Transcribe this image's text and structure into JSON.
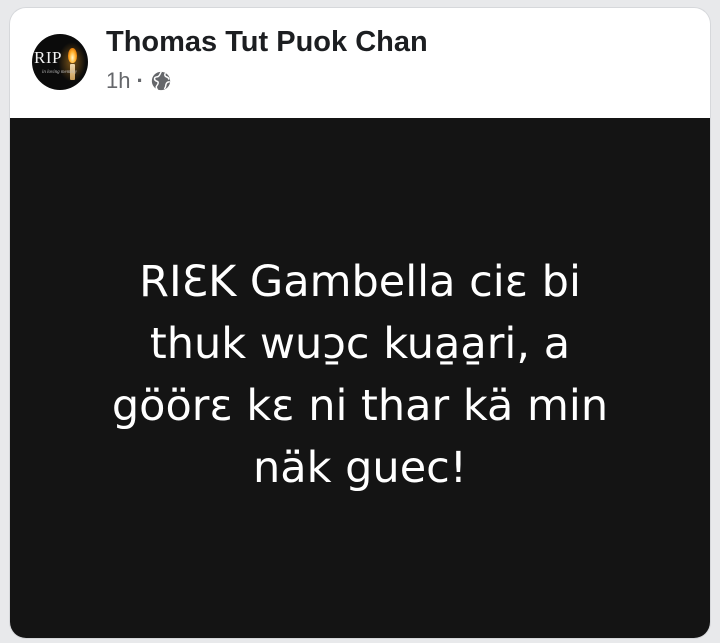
{
  "post": {
    "author": "Thomas Tut Puok Chan",
    "timestamp": "1h",
    "separator": "·",
    "audience_icon": "globe-icon",
    "avatar": {
      "text": "RIP",
      "script_text": "in loving memory",
      "icon": "candle-icon"
    },
    "body_lines": [
      "RIƐK Gambella ciɛ bi",
      "thuk wuɔ̱c kua̱a̱ri, a",
      "göörɛ kɛ ni thar kä min",
      "näk guec!"
    ],
    "background_color": "#141414",
    "text_color": "#ffffff"
  }
}
